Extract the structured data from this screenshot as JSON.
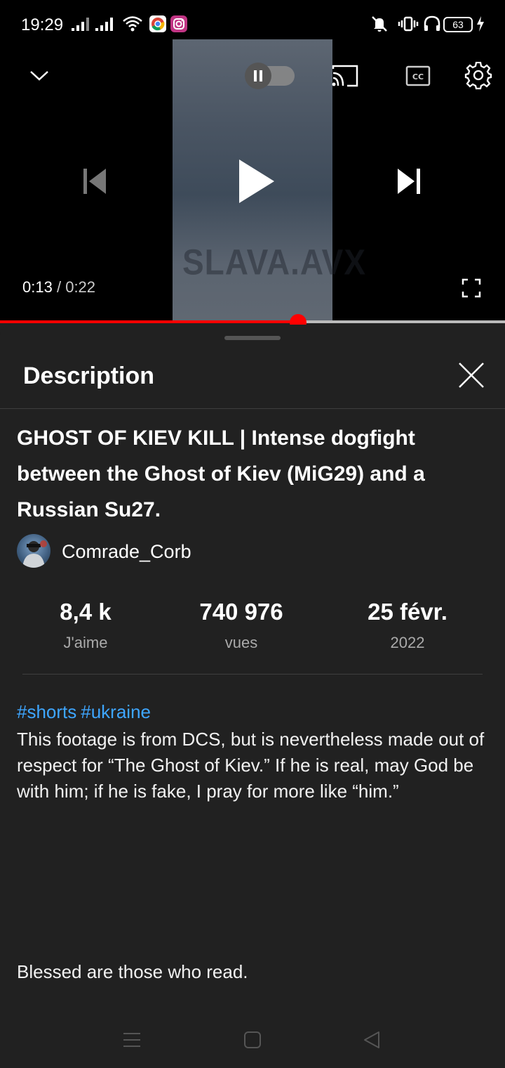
{
  "status_bar": {
    "time": "19:29",
    "battery": "63",
    "icons": [
      "signal-icon",
      "signal-icon",
      "wifi-icon",
      "chrome-icon",
      "instagram-icon",
      "mute-icon",
      "vibrate-icon",
      "headphones-icon",
      "battery-icon",
      "charging-icon"
    ]
  },
  "player": {
    "watermark": "SLAVA.AVX",
    "current_time": "0:13",
    "separator": "/",
    "duration": "0:22",
    "progress_fraction": 0.59,
    "accent_color": "#ff0000",
    "icons": [
      "chevron-down-icon",
      "autoplay-toggle",
      "cast-icon",
      "captions-icon",
      "settings-icon",
      "previous-icon",
      "play-icon",
      "next-icon",
      "fullscreen-icon"
    ]
  },
  "description_panel": {
    "title": "Description",
    "video_title": "GHOST OF KIEV KILL | Intense dogfight between the Ghost of Kiev (MiG29) and a Russian Su27.",
    "channel_name": "Comrade_Corb",
    "stats": [
      {
        "value": "8,4 k",
        "label": "J'aime"
      },
      {
        "value": "740 976",
        "label": "vues"
      },
      {
        "value": "25 févr.",
        "label": "2022"
      }
    ],
    "hashtags": [
      "#shorts",
      "#ukraine"
    ],
    "hashtag_color": "#3ea6ff",
    "description": "This footage is from DCS, but is nevertheless made out of respect for “The Ghost of Kiev.” If he is real, may God be with him; if he is fake, I pray for more like “him.”",
    "footer_text": "Blessed are those who read."
  },
  "nav_bar": {
    "icons": [
      "menu-icon",
      "home-icon",
      "back-icon"
    ]
  }
}
